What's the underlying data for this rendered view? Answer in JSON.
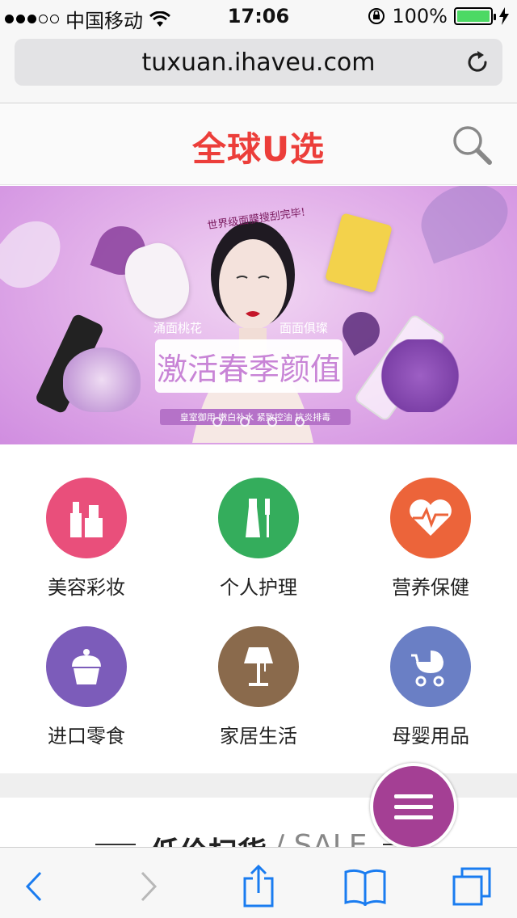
{
  "status_bar": {
    "carrier": "中国移动",
    "time": "17:06",
    "battery_percent": "100%",
    "signal_bars_filled": 3,
    "signal_bars_total": 5
  },
  "browser": {
    "url": "tuxuan.ihaveu.com"
  },
  "site": {
    "logo_text": "全球U选",
    "brand_color": "#ec3e3a"
  },
  "banner": {
    "headline": "激活春季颜值",
    "subline": "皇室御用 嫩白补水 紧致控油 抗炎排毒",
    "arc_text": "世界级面膜搜刮完毕!",
    "side_left": "涌面桃花",
    "side_right": "面面俱璨",
    "slide_count": 4
  },
  "categories": [
    {
      "label": "美容彩妆",
      "color": "#e94f7b",
      "icon": "cosmetics-icon"
    },
    {
      "label": "个人护理",
      "color": "#34ad5c",
      "icon": "toothbrush-icon"
    },
    {
      "label": "营养保健",
      "color": "#ec643a",
      "icon": "heartbeat-icon"
    },
    {
      "label": "进口零食",
      "color": "#7c5cba",
      "icon": "cupcake-icon"
    },
    {
      "label": "家居生活",
      "color": "#8a6a4c",
      "icon": "lamp-icon"
    },
    {
      "label": "母婴用品",
      "color": "#6a7fc5",
      "icon": "stroller-icon"
    }
  ],
  "section": {
    "title": "低价扫货",
    "subtitle": "/ SALE"
  },
  "fab_color": "#a43f94"
}
